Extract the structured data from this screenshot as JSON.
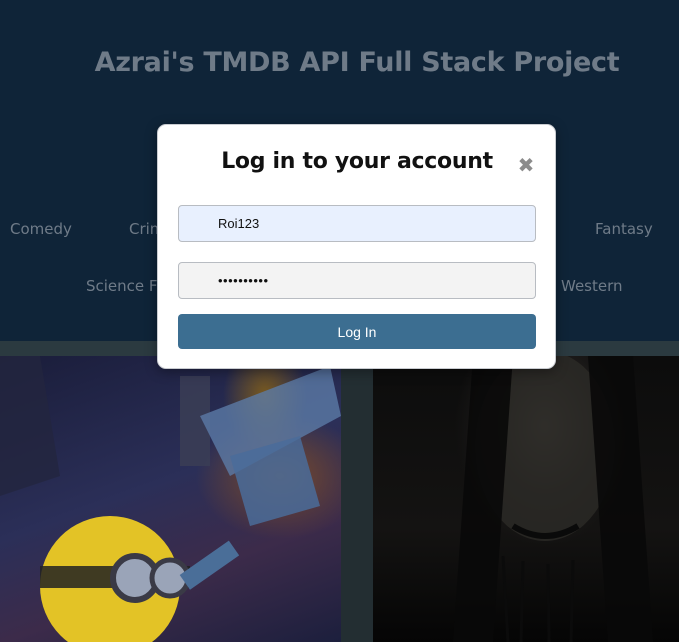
{
  "header": {
    "site_title": "Azrai's TMDB API Full Stack Project"
  },
  "genres": {
    "row1": [
      "Comedy",
      "Crim",
      "Fantasy"
    ],
    "row2": [
      "Science F",
      "Western"
    ]
  },
  "login_modal": {
    "title": "Log in to your account",
    "close_icon": "close-icon",
    "username_value": "Roi123",
    "password_value": "••••••••••",
    "login_label": "Log In"
  },
  "posters": [
    {
      "name": "poster-animated"
    },
    {
      "name": "poster-horror"
    }
  ],
  "colors": {
    "background": "#0f2438",
    "button": "#3c6e91",
    "muted_text": "#6f7b88"
  }
}
